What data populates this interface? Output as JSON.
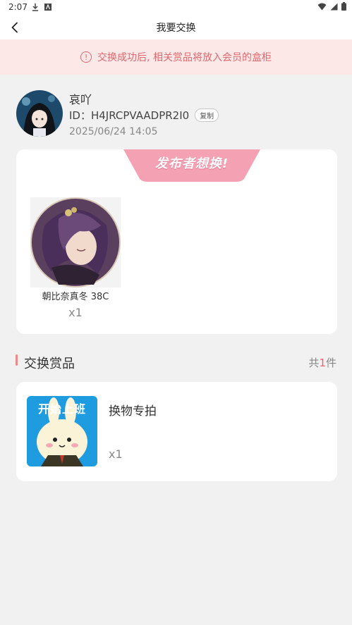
{
  "status_bar": {
    "time": "2:07"
  },
  "header": {
    "title": "我要交换"
  },
  "notice": {
    "text": "交换成功后, 相关赏品将放入会员的盒柜"
  },
  "user": {
    "name": "哀吖",
    "id_label": "ID：H4JRCPVAADPR2I0",
    "copy_label": "复制",
    "datetime": "2025/06/24 14:05"
  },
  "publisher_card": {
    "ribbon_text": "发布者想换!",
    "items": [
      {
        "name": "朝比奈真冬 38C",
        "qty": "x1"
      }
    ]
  },
  "prizes_section": {
    "title": "交换赏品",
    "count_prefix": "共",
    "count": "1",
    "count_suffix": "件",
    "items": [
      {
        "name": "换物专拍",
        "qty": "x1",
        "image_text": "开始上班"
      }
    ]
  },
  "colors": {
    "accent": "#ee5f6a",
    "notice_bg": "#fde8e8",
    "notice_text": "#e0686f",
    "ribbon": "#f4a1b3",
    "page_bg": "#f1f1f1"
  }
}
